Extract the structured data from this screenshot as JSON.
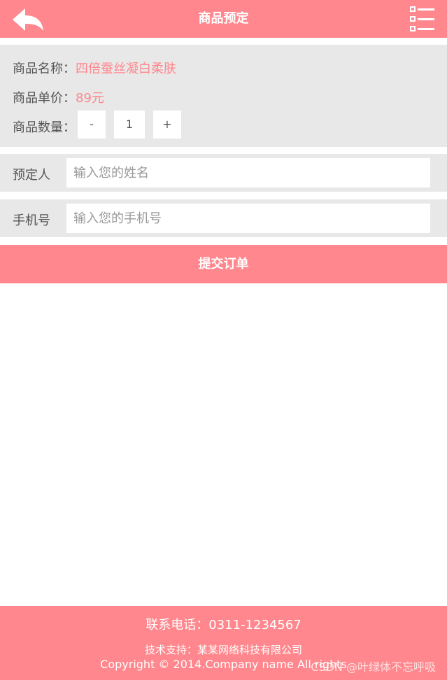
{
  "header": {
    "title": "商品预定",
    "back_icon": "back-arrow-icon",
    "menu_icon": "list-menu-icon"
  },
  "product": {
    "name_label": "商品名称：",
    "name_value": "四倍蚕丝凝白柔肤",
    "price_label": "商品单价：",
    "price_value": "89元",
    "qty_label": "商品数量：",
    "minus": "-",
    "qty_value": "1",
    "plus": "+"
  },
  "form": {
    "name_label": "预定人",
    "name_placeholder": "输入您的姓名",
    "phone_label": "手机号",
    "phone_placeholder": "输入您的手机号"
  },
  "submit_label": "提交订单",
  "footer": {
    "phone": "联系电话：0311-1234567",
    "support": "技术支持：某某网络科技有限公司",
    "copyright": "Copyright © 2014.Company name All rights",
    "watermark": "CSDN @叶绿体不忘呼吸"
  },
  "colors": {
    "accent": "#ff878d",
    "panel": "#e8e8e8"
  }
}
